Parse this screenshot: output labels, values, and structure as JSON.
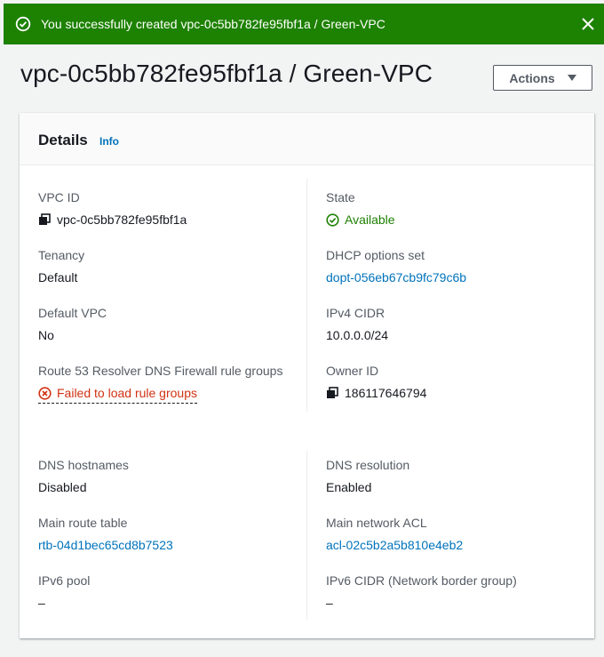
{
  "flash": {
    "message": "You successfully created vpc-0c5bb782fe95fbf1a / Green-VPC",
    "color": "#1d8102"
  },
  "header": {
    "title": "vpc-0c5bb782fe95fbf1a / Green-VPC",
    "actions_label": "Actions"
  },
  "details": {
    "title": "Details",
    "info_label": "Info",
    "vpc_id": {
      "label": "VPC ID",
      "value": "vpc-0c5bb782fe95fbf1a"
    },
    "state": {
      "label": "State",
      "value": "Available"
    },
    "tenancy": {
      "label": "Tenancy",
      "value": "Default"
    },
    "dhcp": {
      "label": "DHCP options set",
      "value": "dopt-056eb67cb9fc79c6b"
    },
    "default_vpc": {
      "label": "Default VPC",
      "value": "No"
    },
    "ipv4_cidr": {
      "label": "IPv4 CIDR",
      "value": "10.0.0.0/24"
    },
    "route53": {
      "label": "Route 53 Resolver DNS Firewall rule groups",
      "value": "Failed to load rule groups"
    },
    "owner_id": {
      "label": "Owner ID",
      "value": "186117646794"
    },
    "dns_hostnames": {
      "label": "DNS hostnames",
      "value": "Disabled"
    },
    "dns_resolution": {
      "label": "DNS resolution",
      "value": "Enabled"
    },
    "main_route_table": {
      "label": "Main route table",
      "value": "rtb-04d1bec65cd8b7523"
    },
    "main_network_acl": {
      "label": "Main network ACL",
      "value": "acl-02c5b2a5b810e4eb2"
    },
    "ipv6_pool": {
      "label": "IPv6 pool",
      "value": "–"
    },
    "ipv6_cidr": {
      "label": "IPv6 CIDR (Network border group)",
      "value": "–"
    }
  }
}
